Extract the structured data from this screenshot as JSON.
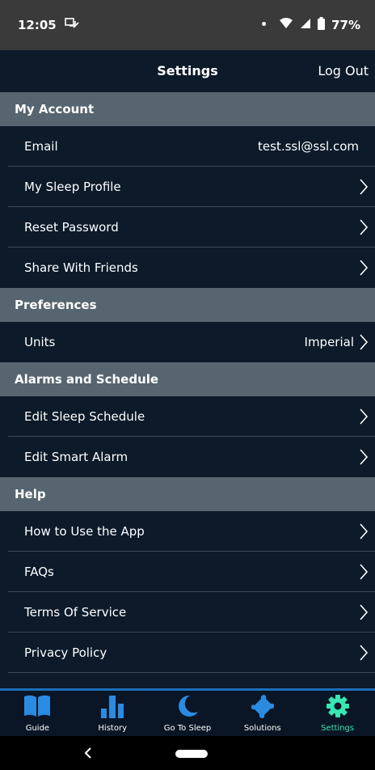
{
  "status_bar": {
    "time": "12:05",
    "battery": "77%"
  },
  "header": {
    "title": "Settings",
    "logout_label": "Log Out"
  },
  "sections": {
    "account": {
      "title": "My Account",
      "email_label": "Email",
      "email_value": "test.ssl@ssl.com",
      "sleep_profile": "My Sleep Profile",
      "reset_password": "Reset Password",
      "share": "Share With Friends"
    },
    "preferences": {
      "title": "Preferences",
      "units_label": "Units",
      "units_value": "Imperial"
    },
    "alarms": {
      "title": "Alarms and Schedule",
      "edit_schedule": "Edit Sleep Schedule",
      "edit_alarm": "Edit Smart Alarm"
    },
    "help": {
      "title": "Help",
      "how_to": "How to Use the App",
      "faqs": "FAQs",
      "terms": "Terms Of Service",
      "privacy": "Privacy Policy"
    }
  },
  "tabs": {
    "guide": "Guide",
    "history": "History",
    "go_to_sleep": "Go To Sleep",
    "solutions": "Solutions",
    "settings": "Settings"
  },
  "colors": {
    "background": "#0c1a2a",
    "section_header": "#56656f",
    "tab_icon_blue": "#2a8be0",
    "tab_active": "#39e6b2"
  },
  "icons": {
    "guide": "book-icon",
    "history": "bar-chart-icon",
    "go_to_sleep": "moon-icon",
    "solutions": "puzzle-icon",
    "settings": "gear-icon"
  }
}
